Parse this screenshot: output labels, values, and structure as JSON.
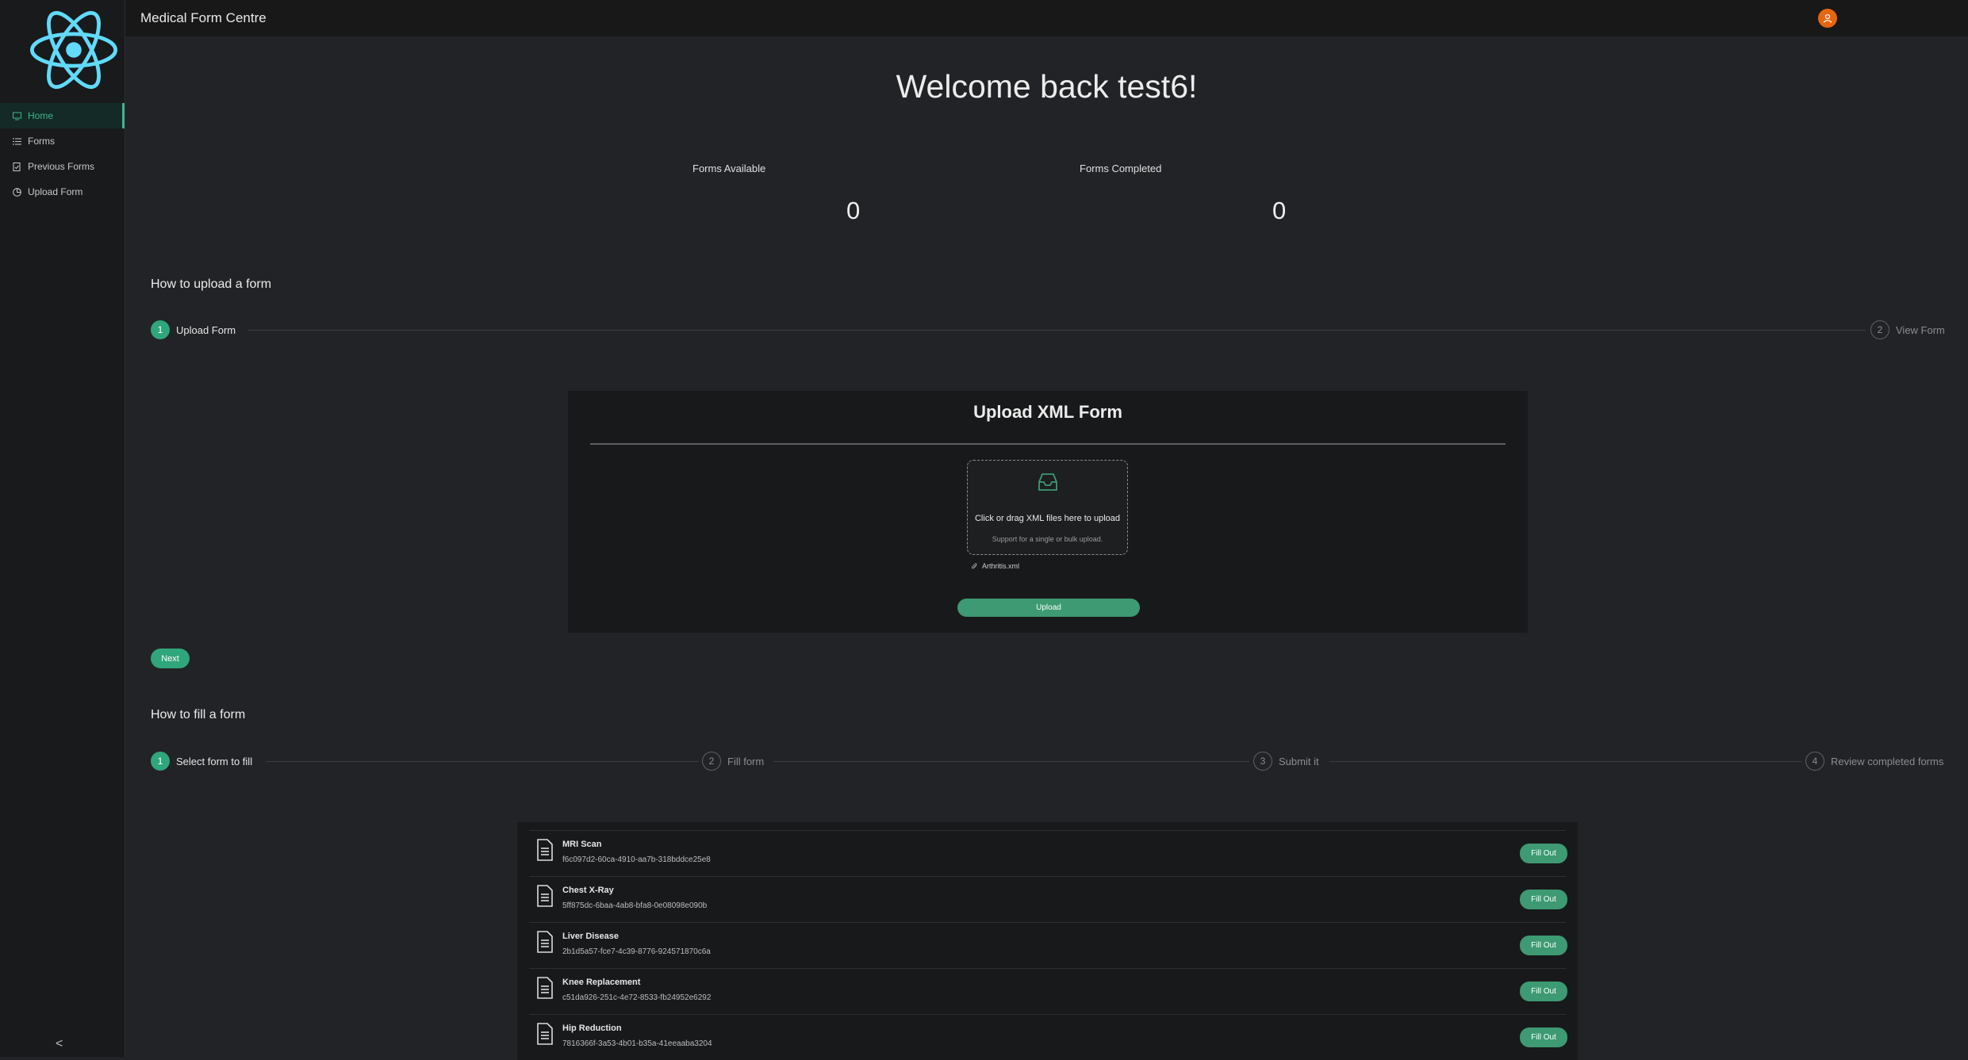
{
  "app": {
    "title": "Medical Form Centre"
  },
  "sidebar": {
    "items": [
      {
        "label": "Home",
        "icon": "desktop-icon"
      },
      {
        "label": "Forms",
        "icon": "list-icon"
      },
      {
        "label": "Previous Forms",
        "icon": "file-done-icon"
      },
      {
        "label": "Upload Form",
        "icon": "pie-chart-icon"
      }
    ],
    "collapse_icon": "<"
  },
  "main": {
    "welcome": "Welcome back test6!",
    "stats": [
      {
        "title": "Forms Available",
        "value": "0"
      },
      {
        "title": "Forms Completed",
        "value": "0"
      }
    ],
    "upload_section": {
      "title": "How to upload a form",
      "steps": [
        {
          "num": "1",
          "label": "Upload Form"
        },
        {
          "num": "2",
          "label": "View Form"
        }
      ],
      "card": {
        "title": "Upload XML Form",
        "drop_text": "Click or drag XML files here to upload",
        "drop_hint": "Support for a single or bulk upload.",
        "file_name": "Arthritis.xml",
        "upload_label": "Upload"
      },
      "next_label": "Next"
    },
    "fill_section": {
      "title": "How to fill a form",
      "steps": [
        {
          "num": "1",
          "label": "Select form to fill"
        },
        {
          "num": "2",
          "label": "Fill form"
        },
        {
          "num": "3",
          "label": "Submit it"
        },
        {
          "num": "4",
          "label": "Review completed forms"
        }
      ],
      "forms": [
        {
          "name": "MRI Scan",
          "id": "f6c097d2-60ca-4910-aa7b-318bddce25e8",
          "action": "Fill Out"
        },
        {
          "name": "Chest X-Ray",
          "id": "5ff875dc-6baa-4ab8-bfa8-0e08098e090b",
          "action": "Fill Out"
        },
        {
          "name": "Liver Disease",
          "id": "2b1d5a57-fce7-4c39-8776-924571870c6a",
          "action": "Fill Out"
        },
        {
          "name": "Knee Replacement",
          "id": "c51da926-251c-4e72-8533-fb24952e6292",
          "action": "Fill Out"
        },
        {
          "name": "Hip Reduction",
          "id": "7816366f-3a53-4b01-b35a-41eeaaba3204",
          "action": "Fill Out"
        }
      ]
    }
  },
  "colors": {
    "accent": "#2fa67b",
    "avatar": "#e8650f",
    "logo": "#61dafb"
  }
}
